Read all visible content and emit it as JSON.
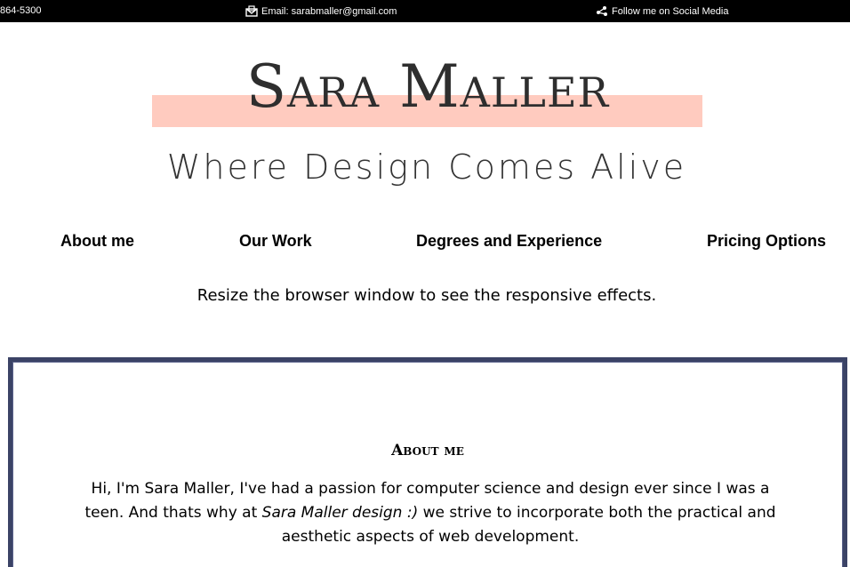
{
  "topbar": {
    "phone": "864-5300",
    "email": "Email: sarabmaller@gmail.com",
    "social": "Follow me on Social Media",
    "background": "#000000",
    "icons": [
      "envelope-icon",
      "social-share-icon"
    ]
  },
  "header": {
    "logo": "Sara Maller",
    "tagline": "Where Design Comes Alive",
    "highlight_color": "#ffcbbf"
  },
  "nav": {
    "items": [
      {
        "label": "About me"
      },
      {
        "label": "Our Work"
      },
      {
        "label": "Degrees and Experience"
      },
      {
        "label": "Pricing Options"
      }
    ]
  },
  "notice": "Resize the browser window to see the responsive effects.",
  "about": {
    "title": "About me",
    "intro": "Hi, I'm Sara Maller, I've had a passion for computer science and design ever since I was a teen. And thats why at ",
    "emphasis": "Sara Maller design :)",
    "outro": " we strive to incorporate both the practical and aesthetic aspects of web development.",
    "border_color": "#3b4366"
  }
}
